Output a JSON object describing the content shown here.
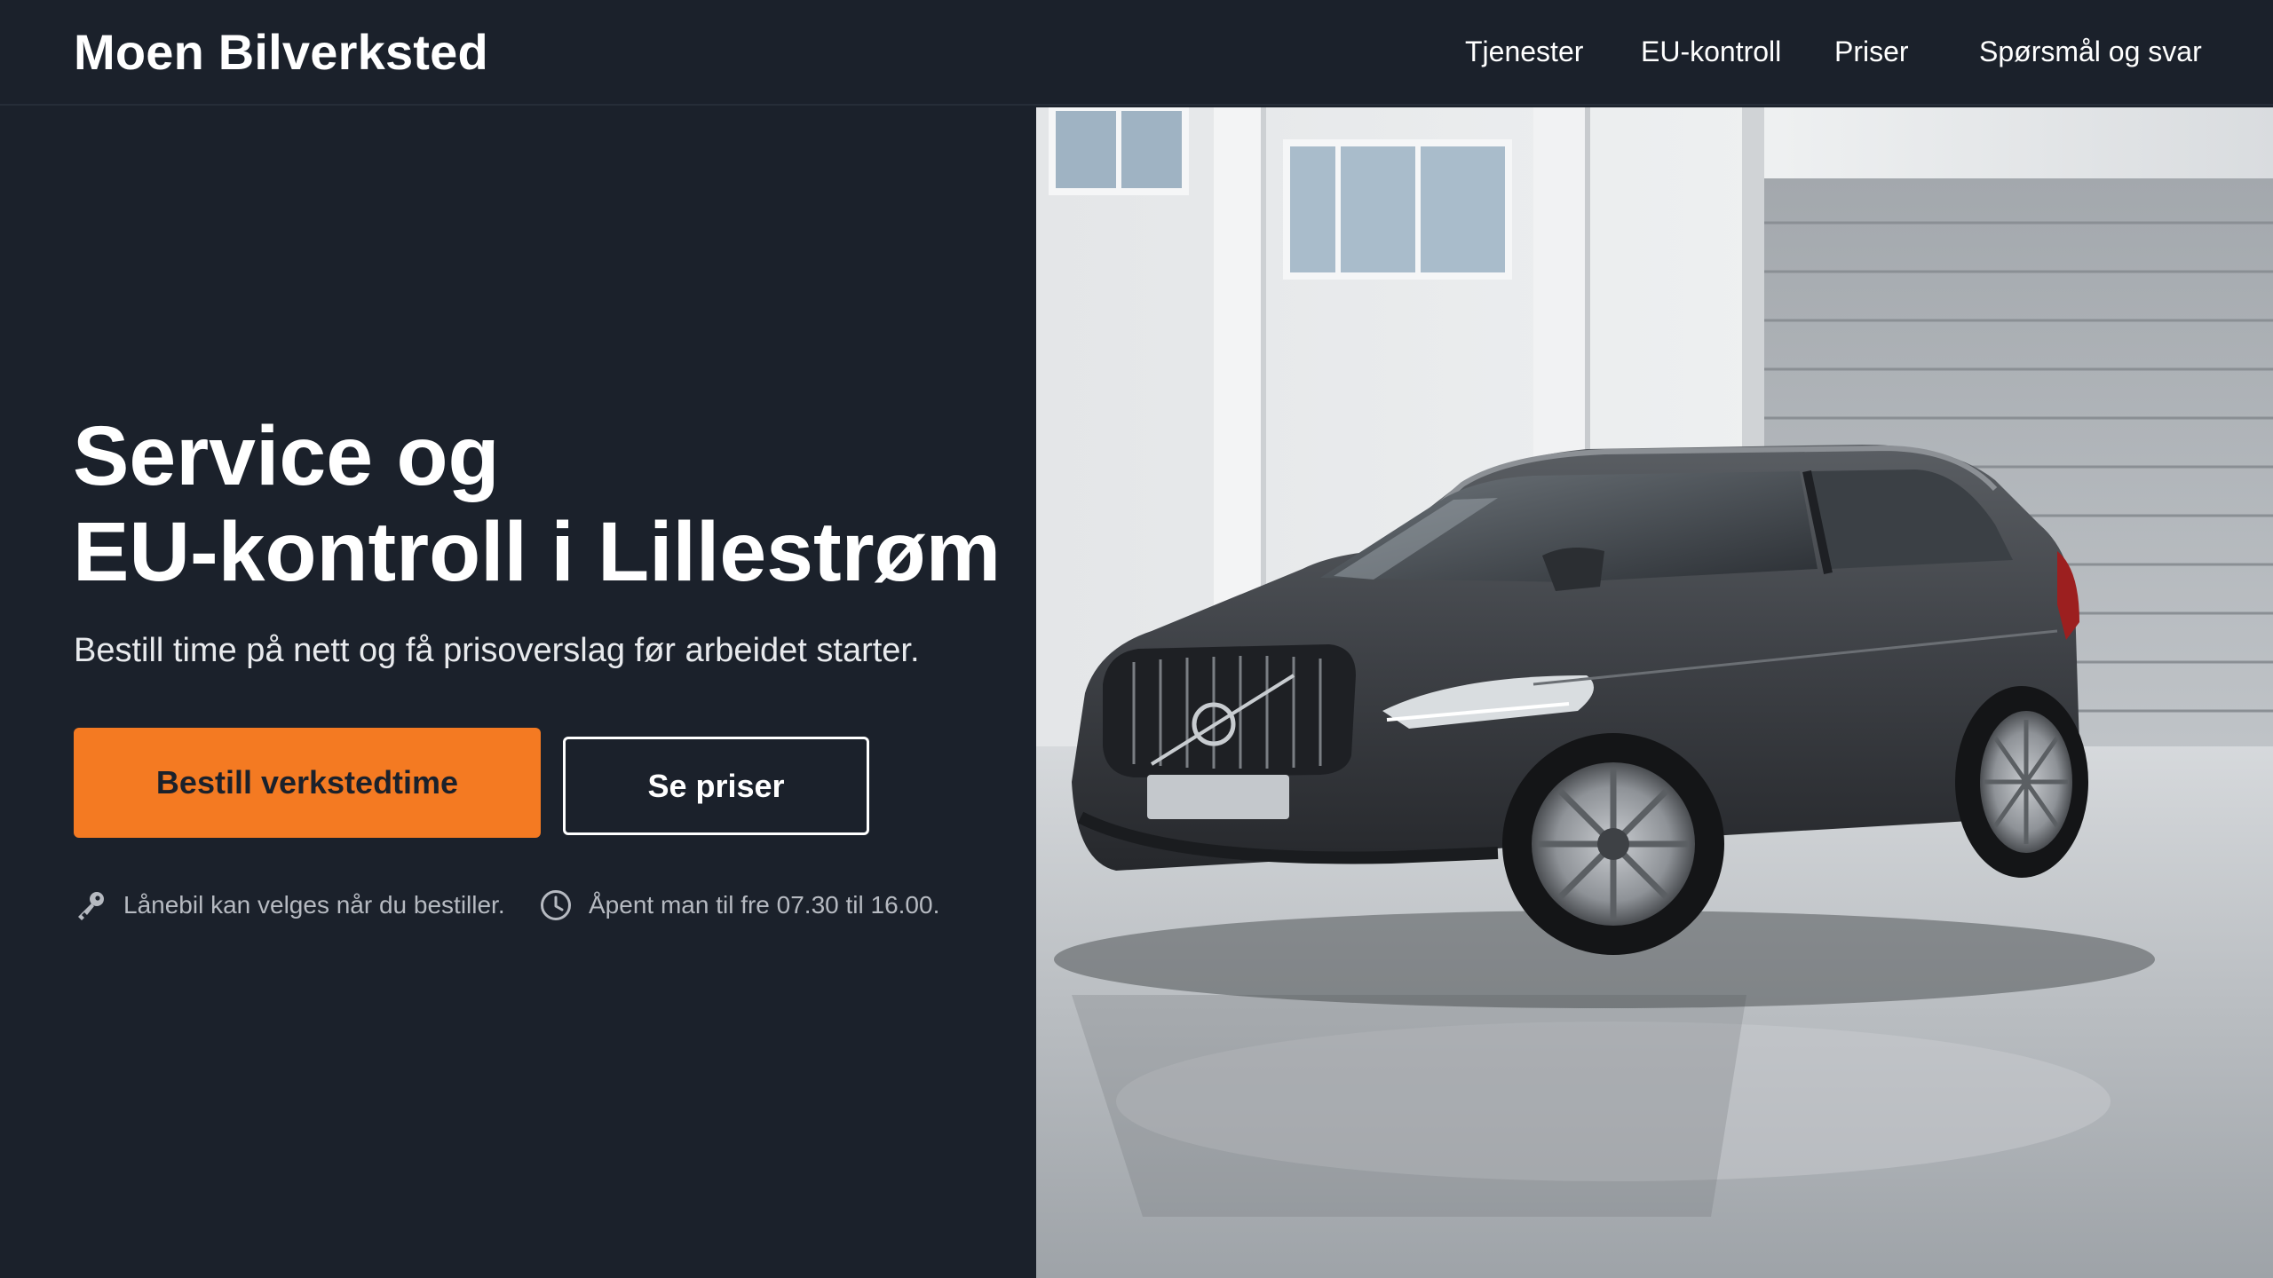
{
  "header": {
    "logo": "Moen Bilverksted",
    "nav": [
      {
        "label": "Tjenester"
      },
      {
        "label": "EU-kontroll"
      },
      {
        "label": "Priser"
      },
      {
        "label": "Spørsmål og svar"
      }
    ]
  },
  "hero": {
    "headline_line1": "Service og",
    "headline_line2": "EU-kontroll i Lillestrøm",
    "subline": "Bestill time på nett og få prisoverslag før arbeidet starter.",
    "primary_button": "Bestill verkstedtime",
    "secondary_button": "Se priser",
    "info": [
      {
        "icon": "key-icon",
        "text": "Lånebil kan velges når du bestiller."
      },
      {
        "icon": "clock-icon",
        "text": "Åpent man til fre 07.30 til 16.00."
      }
    ],
    "image": {
      "subject": "dark grey station wagon in bright workshop garage",
      "icon": "car-photo"
    }
  },
  "colors": {
    "background": "#1b212b",
    "accent": "#f47a22",
    "text": "#ffffff",
    "muted": "#b6bac1"
  }
}
